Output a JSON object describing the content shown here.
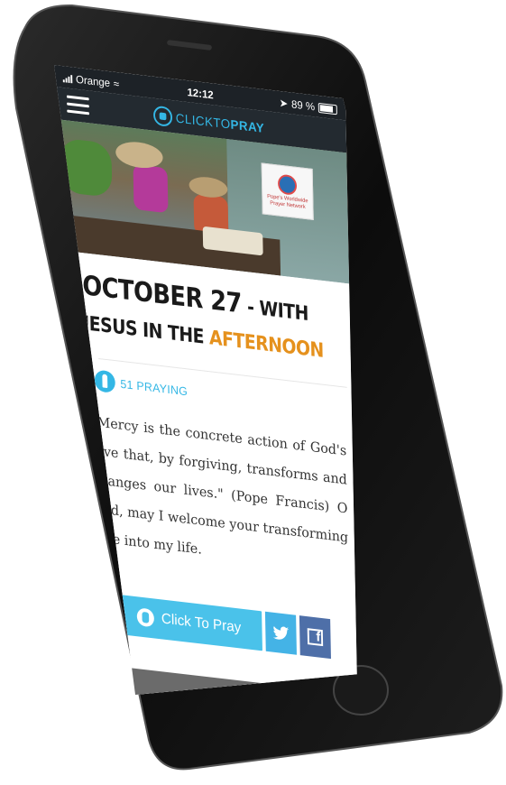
{
  "status_bar": {
    "carrier": "Orange",
    "time": "12:12",
    "battery": "89 %"
  },
  "nav": {
    "logo_part1": "CLICK",
    "logo_part2": "TO",
    "logo_part3": "PRAY"
  },
  "hero": {
    "badge_text": "Pope's Worldwide Prayer Network"
  },
  "article": {
    "title_date": "OCTOBER 27",
    "title_dash": " - ",
    "title_rest": "WITH JESUS IN THE ",
    "title_accent": "AFTERNOON",
    "praying_count": "51 PRAYING",
    "quote": "\"Mercy is the concrete action of God's love that, by forgiving, transforms and changes our lives.\" (Pope Francis) O God, may I welcome your transforming love into my life."
  },
  "actions": {
    "pray_label": "Click To Pray",
    "twitter_icon": "twitter-icon",
    "facebook_icon": "facebook-icon",
    "facebook_glyph": "f"
  },
  "colors": {
    "accent_blue": "#34b7e5",
    "accent_orange": "#e5911d",
    "facebook": "#4e6fa8"
  }
}
